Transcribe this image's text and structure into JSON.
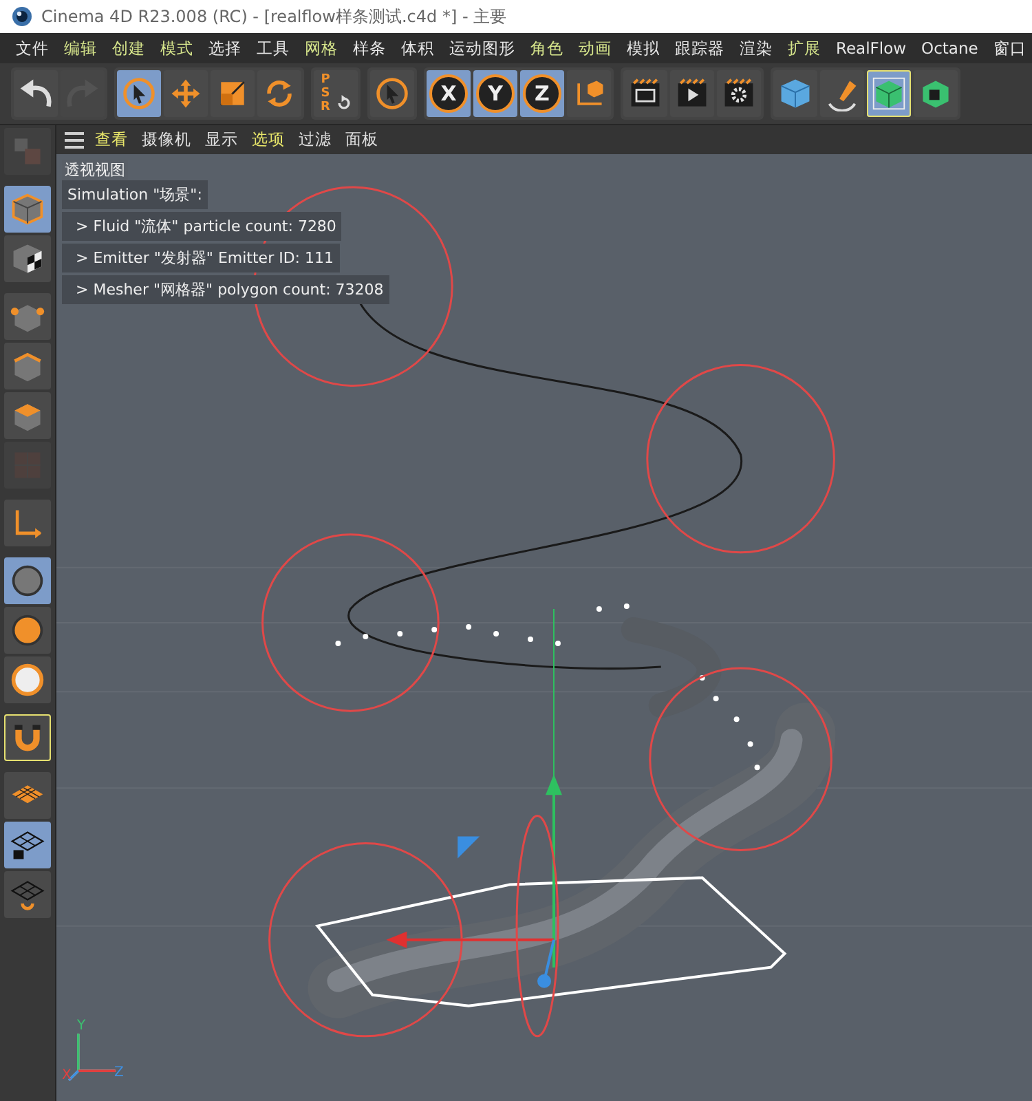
{
  "window": {
    "title": "Cinema 4D R23.008 (RC) - [realflow样条测试.c4d *] - 主要"
  },
  "menu": [
    {
      "label": "文件",
      "highlighted": false
    },
    {
      "label": "编辑",
      "highlighted": true
    },
    {
      "label": "创建",
      "highlighted": true
    },
    {
      "label": "模式",
      "highlighted": true
    },
    {
      "label": "选择",
      "highlighted": false
    },
    {
      "label": "工具",
      "highlighted": false
    },
    {
      "label": "网格",
      "highlighted": true
    },
    {
      "label": "样条",
      "highlighted": false
    },
    {
      "label": "体积",
      "highlighted": false
    },
    {
      "label": "运动图形",
      "highlighted": false
    },
    {
      "label": "角色",
      "highlighted": true
    },
    {
      "label": "动画",
      "highlighted": true
    },
    {
      "label": "模拟",
      "highlighted": false
    },
    {
      "label": "跟踪器",
      "highlighted": false
    },
    {
      "label": "渲染",
      "highlighted": false
    },
    {
      "label": "扩展",
      "highlighted": true
    },
    {
      "label": "RealFlow",
      "highlighted": false
    },
    {
      "label": "Octane",
      "highlighted": false
    },
    {
      "label": "窗口",
      "highlighted": false
    }
  ],
  "toolbar": [
    [
      {
        "kind": "undo",
        "selected": false,
        "disabled": false
      },
      {
        "kind": "redo",
        "selected": false,
        "disabled": true
      }
    ],
    [
      {
        "kind": "cursor",
        "selected": true,
        "disabled": false
      },
      {
        "kind": "move",
        "selected": false,
        "disabled": false
      },
      {
        "kind": "scale",
        "selected": false,
        "disabled": false
      },
      {
        "kind": "rotate",
        "selected": false,
        "disabled": false
      }
    ],
    [
      {
        "kind": "psr",
        "label": "PSR",
        "selected": false,
        "disabled": false
      }
    ],
    [
      {
        "kind": "cursor",
        "selected": false,
        "disabled": false
      }
    ],
    [
      {
        "kind": "axis",
        "label": "X",
        "selected": true,
        "disabled": false
      },
      {
        "kind": "axis",
        "label": "Y",
        "selected": true,
        "disabled": false
      },
      {
        "kind": "axis",
        "label": "Z",
        "selected": true,
        "disabled": false
      },
      {
        "kind": "coords",
        "selected": false,
        "disabled": false
      }
    ],
    [
      {
        "kind": "render-view",
        "selected": false,
        "disabled": false
      },
      {
        "kind": "render",
        "selected": false,
        "disabled": false
      },
      {
        "kind": "render-settings",
        "selected": false,
        "disabled": false
      }
    ],
    [
      {
        "kind": "cube",
        "selected": false,
        "disabled": false
      },
      {
        "kind": "pen",
        "selected": false,
        "disabled": false
      },
      {
        "kind": "subdivision",
        "selected": true,
        "disabled": false
      },
      {
        "kind": "extrude",
        "selected": false,
        "disabled": false
      }
    ]
  ],
  "palette": [
    [
      {
        "kind": "workspace",
        "selected": false,
        "disabled": true
      }
    ],
    [
      {
        "kind": "model",
        "selected": true,
        "disabled": false
      },
      {
        "kind": "texture",
        "selected": false,
        "disabled": false
      }
    ],
    [
      {
        "kind": "points",
        "selected": false,
        "disabled": false
      },
      {
        "kind": "edges",
        "selected": false,
        "disabled": false
      },
      {
        "kind": "polygons",
        "selected": false,
        "disabled": false
      },
      {
        "kind": "uv",
        "selected": false,
        "disabled": true
      }
    ],
    [
      {
        "kind": "axis-mode",
        "selected": false,
        "disabled": false
      }
    ],
    [
      {
        "kind": "snap",
        "selected": true,
        "disabled": false
      },
      {
        "kind": "snap-orange",
        "selected": false,
        "disabled": false
      },
      {
        "kind": "snap-white",
        "selected": false,
        "disabled": false
      }
    ],
    [
      {
        "kind": "magnet",
        "selected": false,
        "disabled": false
      }
    ],
    [
      {
        "kind": "workplane",
        "selected": false,
        "disabled": false
      },
      {
        "kind": "grid-lock",
        "selected": true,
        "disabled": false
      },
      {
        "kind": "grid-rotate",
        "selected": false,
        "disabled": false
      }
    ]
  ],
  "viewport": {
    "menu": [
      {
        "label": "查看",
        "highlighted": true
      },
      {
        "label": "摄像机",
        "highlighted": false
      },
      {
        "label": "显示",
        "highlighted": false
      },
      {
        "label": "选项",
        "highlighted": true
      },
      {
        "label": "过滤",
        "highlighted": false
      },
      {
        "label": "面板",
        "highlighted": false
      }
    ],
    "camera_label": "透视视图",
    "hud": [
      "Simulation \"场景\":",
      "> Fluid \"流体\" particle count: 7280",
      "> Emitter \"发射器\" Emitter ID: 111",
      "> Mesher \"网格器\" polygon count: 73208"
    ],
    "axis_gizmo": {
      "x": "X",
      "y": "Y",
      "z": "Z"
    }
  }
}
